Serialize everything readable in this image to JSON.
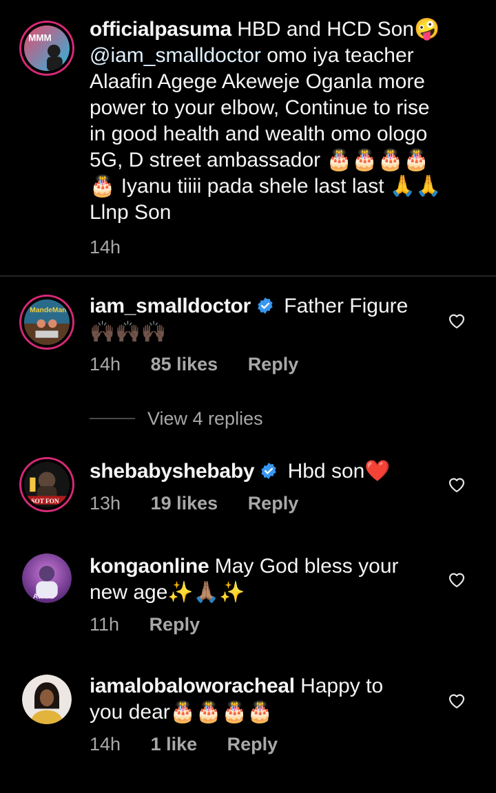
{
  "caption": {
    "username": "officialpasuma",
    "text_before_mention": " HBD and HCD Son🤪 ",
    "mention": "@iam_smalldoctor",
    "text_after_mention": " omo iya teacher Alaafin Agege Akeweje Oganla more power to your elbow, Continue to rise in good health and wealth omo ologo 5G, D street ambassador 🎂🎂🎂🎂🎂 Iyanu tiiii pada shele last last 🙏🙏 Llnp Son",
    "time": "14h",
    "avatar_icon": "mmm-logo-avatar"
  },
  "comments": [
    {
      "username": "iam_smalldoctor",
      "verified": true,
      "text": " Father Figure 🙌🏿🙌🏿🙌🏿",
      "time": "14h",
      "likes": "85 likes",
      "reply": "Reply",
      "view_replies": "View 4 replies",
      "avatar_icon": "mandemon-avatar"
    },
    {
      "username": "shebabyshebaby",
      "verified": true,
      "text": " Hbd son❤️",
      "time": "13h",
      "likes": "19 likes",
      "reply": "Reply",
      "avatar_icon": "sot-fon-avatar"
    },
    {
      "username": "kongaonline",
      "verified": false,
      "text": " May God bless your new age✨🙏🏽✨",
      "time": "11h",
      "reply": "Reply",
      "avatar_icon": "awol-avatar"
    },
    {
      "username": "iamalobaloworacheal",
      "verified": false,
      "text": " Happy to you dear🎂🎂🎂🎂",
      "time": "14h",
      "likes": "1 like",
      "reply": "Reply",
      "avatar_icon": "portrait-avatar"
    }
  ],
  "colors": {
    "background": "#000000",
    "text": "#f5f5f5",
    "secondary": "#a8a8a8",
    "verified": "#3897f0",
    "story_ring": "#d62976"
  }
}
